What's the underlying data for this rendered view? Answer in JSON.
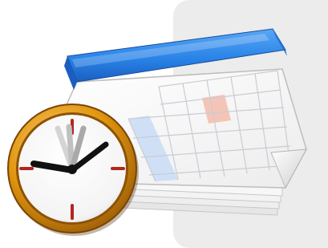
{
  "icon": {
    "name": "calendar-clock-icon",
    "subject": [
      "calendar",
      "clock"
    ]
  },
  "colors": {
    "panel": "#ececec",
    "calendar_header": "#2a84e8",
    "calendar_header_dark": "#1a5fc0",
    "calendar_page": "#fbfbfb",
    "grid_line": "#c9ccd4",
    "highlight_cell": "#f4c5b6",
    "weekend_column": "#cfe0f6",
    "clock_rim": "#d88a12",
    "clock_rim_dark": "#8e5206",
    "clock_hand": "#111111",
    "clock_tick": "#b3261e",
    "clock_ghost_hand": "#9a9a9a"
  },
  "calendar": {
    "columns": 6,
    "rows": 5,
    "highlight_cell": {
      "row": 1,
      "col": 3
    },
    "weekend_column": 0
  },
  "clock": {
    "hour_hand_clock_position": 9.5,
    "minute_hand_clock_position": 2,
    "ghost_hand_count": 3,
    "tick_marks": [
      12,
      3,
      6,
      9
    ]
  }
}
